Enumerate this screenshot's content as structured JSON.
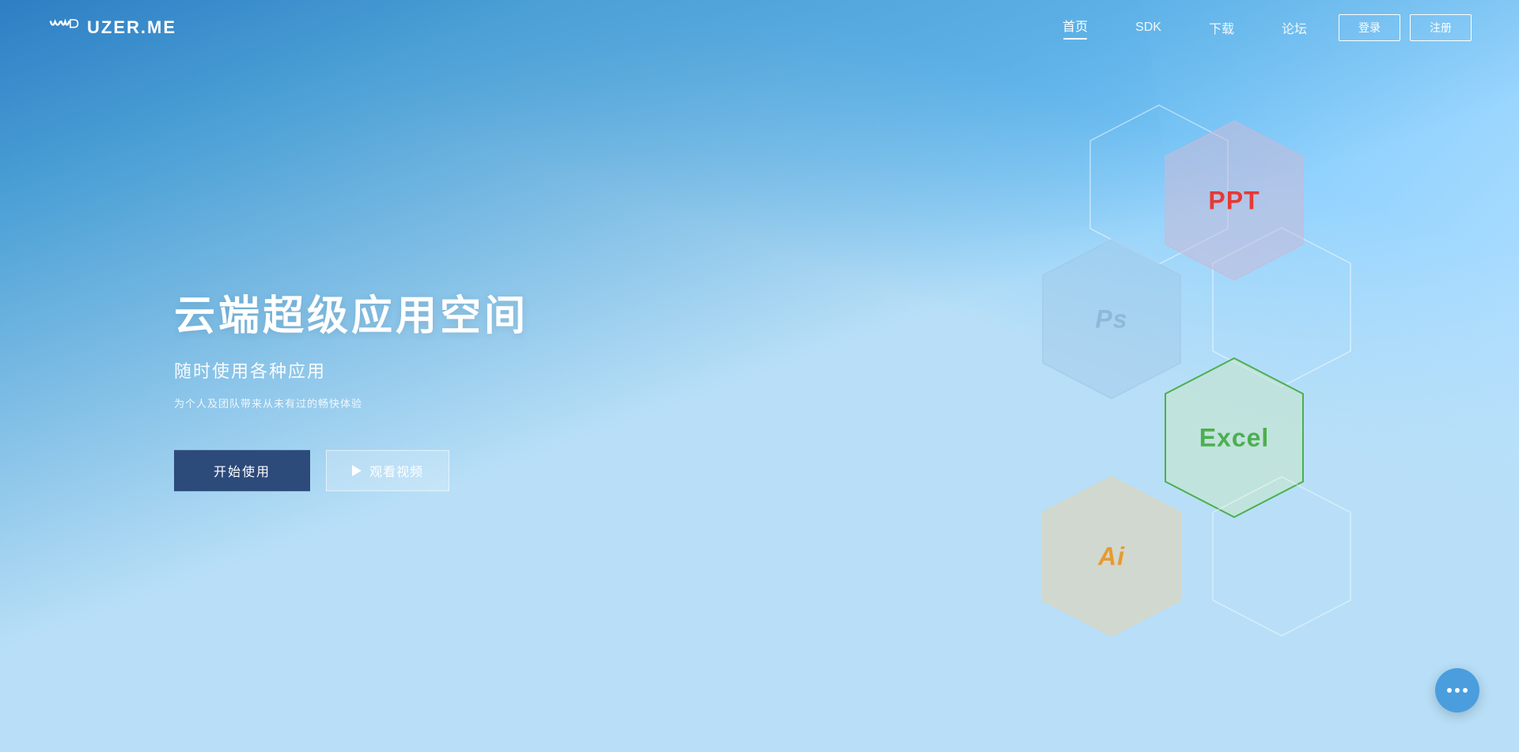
{
  "site": {
    "logo_text": "UZER.ME"
  },
  "navbar": {
    "links": [
      {
        "label": "首页",
        "active": true
      },
      {
        "label": "SDK",
        "active": false
      },
      {
        "label": "下载",
        "active": false
      },
      {
        "label": "论坛",
        "active": false
      }
    ],
    "btn_login": "登录",
    "btn_register": "注册"
  },
  "hero": {
    "title": "云端超级应用空间",
    "subtitle": "随时使用各种应用",
    "description": "为个人及团队带来从未有过的畅快体验",
    "btn_start": "开始使用",
    "btn_video": "观看视频"
  },
  "hexagons": [
    {
      "id": "ppt",
      "label": "PPT",
      "color": "#e53935",
      "fill": "rgba(200,185,215,0.55)",
      "stroke": "rgba(200,185,215,0.7)"
    },
    {
      "id": "ps",
      "label": "Ps",
      "color": "#90b8d8",
      "fill": "rgba(160,200,230,0.45)",
      "stroke": "rgba(160,200,230,0.7)"
    },
    {
      "id": "excel",
      "label": "Excel",
      "color": "#4caf50",
      "fill": "rgba(200,230,200,0.55)",
      "stroke": "#4caf50"
    },
    {
      "id": "ai",
      "label": "Ai",
      "color": "#e89a30",
      "fill": "rgba(230,210,175,0.55)",
      "stroke": "rgba(230,210,175,0.7)"
    }
  ],
  "colors": {
    "brand_blue": "#3a9fe8",
    "nav_bg": "transparent",
    "hero_bg_start": "#3a8fd4",
    "hero_bg_end": "#a8d8f0"
  }
}
